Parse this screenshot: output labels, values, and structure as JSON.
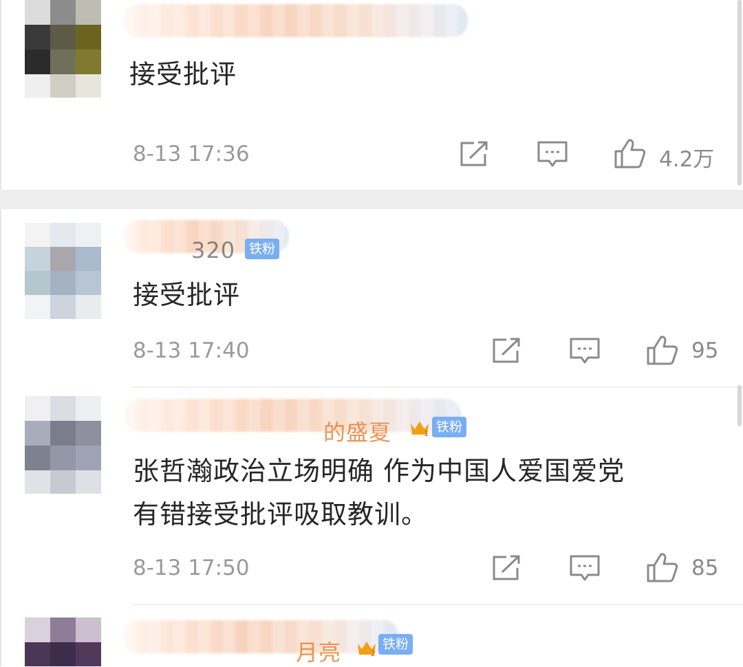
{
  "comments": [
    {
      "text": "接受批评",
      "timestamp": "8-13 17:36",
      "likes": "4.2万",
      "name_fragment": "",
      "badge": ""
    },
    {
      "text": "接受批评",
      "timestamp": "8-13 17:40",
      "likes": "95",
      "name_fragment": "320",
      "badge": "铁粉"
    },
    {
      "text_line1": "张哲瀚政治立场明确 作为中国人爱国爱党",
      "text_line2": "有错接受批评吸取教训。",
      "timestamp": "8-13 17:50",
      "likes": "85",
      "name_fragment": "的盛夏",
      "badge": "铁粉",
      "crown_level": "1"
    },
    {
      "text": "",
      "timestamp": "",
      "likes": "",
      "name_fragment": "月亮",
      "badge": "铁粉",
      "crown_level": "2"
    }
  ],
  "icons": {
    "share": "share-icon",
    "comment": "comment-icon",
    "like": "thumbs-up-icon",
    "crown": "crown-icon"
  },
  "colors": {
    "badge": "#79aef2",
    "crown": "#f2a011",
    "text": "#262626",
    "meta": "#9a9a9a"
  }
}
